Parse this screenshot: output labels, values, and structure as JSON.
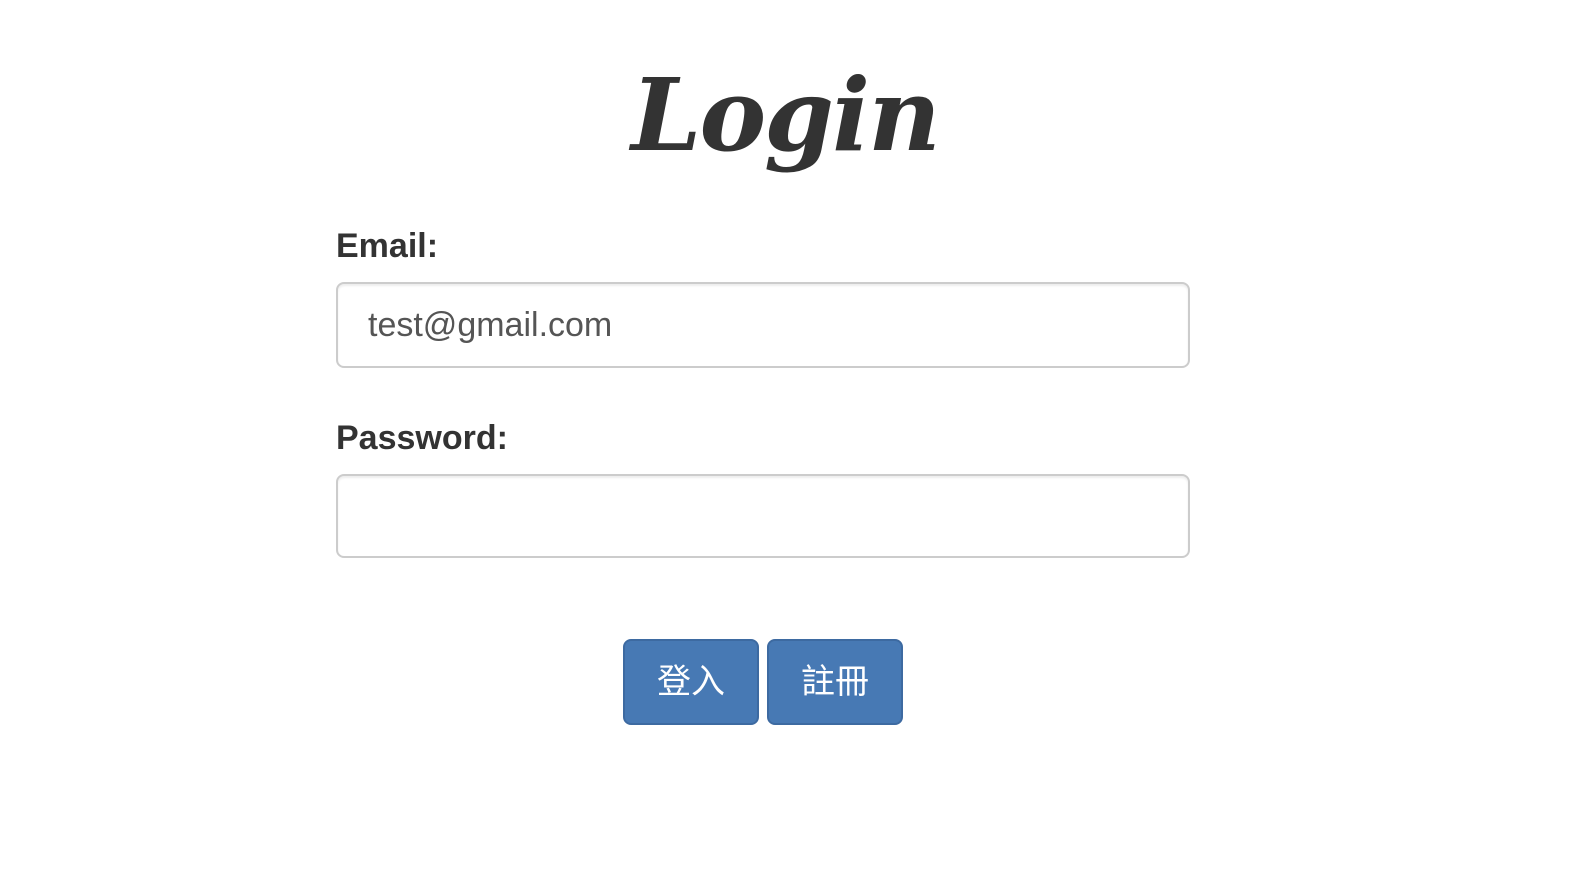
{
  "page": {
    "title": "Login"
  },
  "form": {
    "email": {
      "label": "Email:",
      "value": "test@gmail.com",
      "placeholder": ""
    },
    "password": {
      "label": "Password:",
      "value": "",
      "placeholder": ""
    }
  },
  "buttons": {
    "login_label": "登入",
    "register_label": "註冊"
  },
  "colors": {
    "button_bg": "#4779b4",
    "text": "#333333",
    "input_border": "#cccccc"
  }
}
